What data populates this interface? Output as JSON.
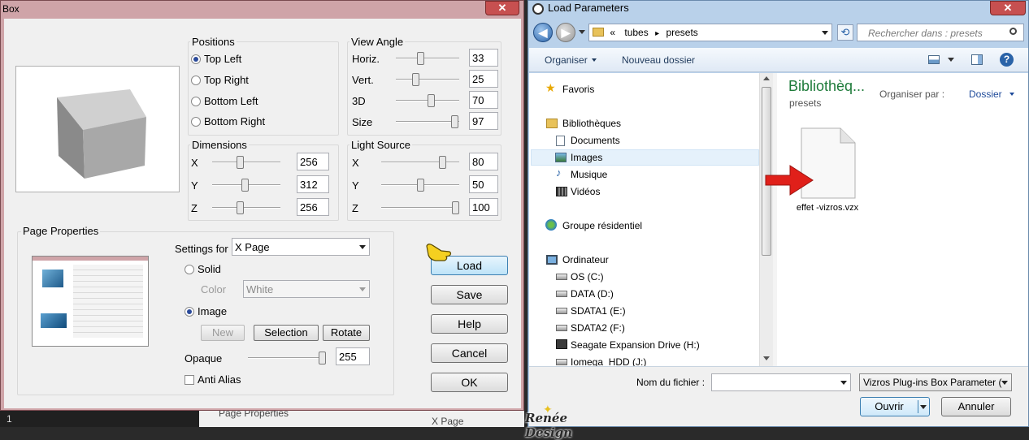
{
  "box_dialog": {
    "title": "Box",
    "close_glyph": "✕",
    "positions": {
      "title": "Positions",
      "options": [
        "Top Left",
        "Top Right",
        "Bottom Left",
        "Bottom Right"
      ],
      "selected": "Top Left"
    },
    "view_angle": {
      "title": "View Angle",
      "sliders": [
        {
          "label": "Horiz.",
          "value": "33"
        },
        {
          "label": "Vert.",
          "value": "25"
        },
        {
          "label": "3D",
          "value": "70"
        },
        {
          "label": "Size",
          "value": "97"
        }
      ]
    },
    "dimensions": {
      "title": "Dimensions",
      "sliders": [
        {
          "label": "X",
          "value": "256"
        },
        {
          "label": "Y",
          "value": "312"
        },
        {
          "label": "Z",
          "value": "256"
        }
      ]
    },
    "light_source": {
      "title": "Light Source",
      "sliders": [
        {
          "label": "X",
          "value": "80"
        },
        {
          "label": "Y",
          "value": "50"
        },
        {
          "label": "Z",
          "value": "100"
        }
      ]
    },
    "page_properties": {
      "title": "Page Properties",
      "settings_for_label": "Settings for",
      "settings_for_value": "X Page",
      "solid_label": "Solid",
      "color_label": "Color",
      "color_value": "White",
      "image_label": "Image",
      "new_label": "New",
      "selection_label": "Selection",
      "rotate_label": "Rotate",
      "opaque_label": "Opaque",
      "opaque_value": "255",
      "anti_alias_label": "Anti Alias"
    },
    "buttons": {
      "load": "Load",
      "save": "Save",
      "help": "Help",
      "cancel": "Cancel",
      "ok": "OK"
    }
  },
  "background_snippet": {
    "page_properties": "Page Properties",
    "x_page": "X Page",
    "row_number": "1"
  },
  "watermark": "Renée Design",
  "load_dialog": {
    "title": "Load Parameters",
    "close_glyph": "✕",
    "address": {
      "overflow": "«",
      "segments": [
        "tubes",
        "presets"
      ],
      "separator": "▸"
    },
    "search_placeholder": "Rechercher dans : presets",
    "toolbar": {
      "organize": "Organiser",
      "new_folder": "Nouveau dossier"
    },
    "nav": {
      "favorites": "Favoris",
      "libraries": "Bibliothèques",
      "library_items": [
        "Documents",
        "Images",
        "Musique",
        "Vidéos"
      ],
      "homegroup": "Groupe résidentiel",
      "computer": "Ordinateur",
      "drives": [
        "OS (C:)",
        "DATA (D:)",
        "SDATA1 (E:)",
        "SDATA2 (F:)",
        "Seagate Expansion Drive (H:)",
        "Iomega_HDD (J:)"
      ]
    },
    "content": {
      "library_title": "Bibliothèq...",
      "library_subtitle": "presets",
      "arrange_label": "Organiser par :",
      "arrange_value": "Dossier",
      "file_name": "effet -vizros.vzx"
    },
    "filename_label": "Nom du fichier :",
    "filename_value": "",
    "filter_value": "Vizros Plug-ins Box Parameter (",
    "open_label": "Ouvrir",
    "cancel_label": "Annuler"
  },
  "colors": {
    "accent": "#2a63a8",
    "library_title": "#1e7b3a",
    "arrow": "#e0201a"
  }
}
